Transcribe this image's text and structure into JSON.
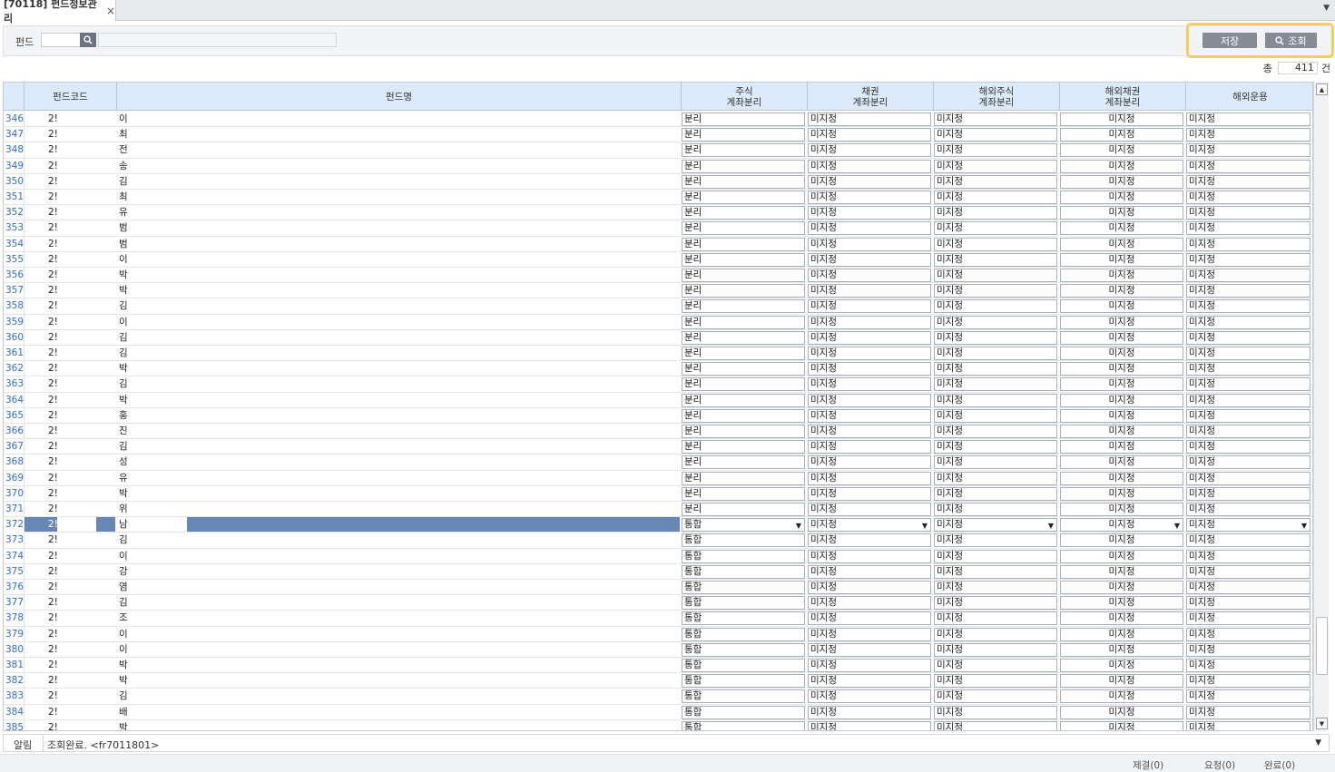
{
  "tab": {
    "title": "[70118] 펀드정보관리",
    "close": "×"
  },
  "search": {
    "label": "펀드",
    "code_value": "",
    "name_value": ""
  },
  "buttons": {
    "save": "저장",
    "query": "조회"
  },
  "count": {
    "prefix": "총",
    "value": "411",
    "suffix": "건"
  },
  "columns": [
    {
      "key": "code",
      "label": "펀드코드"
    },
    {
      "key": "name",
      "label": "펀드명"
    },
    {
      "key": "stock",
      "label": "주식\n계좌분리"
    },
    {
      "key": "bond",
      "label": "채권\n계좌분리"
    },
    {
      "key": "ostock",
      "label": "해외주식\n계좌분리"
    },
    {
      "key": "obond",
      "label": "해외채권\n계좌분리"
    },
    {
      "key": "overseas",
      "label": "해외운용"
    }
  ],
  "selected_row": 372,
  "rows": [
    {
      "no": "346",
      "code": "2!",
      "name": "이",
      "stock": "분리",
      "bond": "미지정",
      "ostock": "미지정",
      "obond": "미지정",
      "overseas": "미지정"
    },
    {
      "no": "347",
      "code": "2!",
      "name": "최",
      "stock": "분리",
      "bond": "미지정",
      "ostock": "미지정",
      "obond": "미지정",
      "overseas": "미지정"
    },
    {
      "no": "348",
      "code": "2!",
      "name": "전",
      "stock": "분리",
      "bond": "미지정",
      "ostock": "미지정",
      "obond": "미지정",
      "overseas": "미지정"
    },
    {
      "no": "349",
      "code": "2!",
      "name": "송",
      "stock": "분리",
      "bond": "미지정",
      "ostock": "미지정",
      "obond": "미지정",
      "overseas": "미지정"
    },
    {
      "no": "350",
      "code": "2!",
      "name": "김",
      "stock": "분리",
      "bond": "미지정",
      "ostock": "미지정",
      "obond": "미지정",
      "overseas": "미지정"
    },
    {
      "no": "351",
      "code": "2!",
      "name": "최",
      "stock": "분리",
      "bond": "미지정",
      "ostock": "미지정",
      "obond": "미지정",
      "overseas": "미지정"
    },
    {
      "no": "352",
      "code": "2!",
      "name": "유",
      "stock": "분리",
      "bond": "미지정",
      "ostock": "미지정",
      "obond": "미지정",
      "overseas": "미지정"
    },
    {
      "no": "353",
      "code": "2!",
      "name": "범",
      "stock": "분리",
      "bond": "미지정",
      "ostock": "미지정",
      "obond": "미지정",
      "overseas": "미지정"
    },
    {
      "no": "354",
      "code": "2!",
      "name": "범",
      "stock": "분리",
      "bond": "미지정",
      "ostock": "미지정",
      "obond": "미지정",
      "overseas": "미지정"
    },
    {
      "no": "355",
      "code": "2!",
      "name": "이",
      "stock": "분리",
      "bond": "미지정",
      "ostock": "미지정",
      "obond": "미지정",
      "overseas": "미지정"
    },
    {
      "no": "356",
      "code": "2!",
      "name": "박",
      "stock": "분리",
      "bond": "미지정",
      "ostock": "미지정",
      "obond": "미지정",
      "overseas": "미지정"
    },
    {
      "no": "357",
      "code": "2!",
      "name": "박",
      "stock": "분리",
      "bond": "미지정",
      "ostock": "미지정",
      "obond": "미지정",
      "overseas": "미지정"
    },
    {
      "no": "358",
      "code": "2!",
      "name": "김",
      "stock": "분리",
      "bond": "미지정",
      "ostock": "미지정",
      "obond": "미지정",
      "overseas": "미지정"
    },
    {
      "no": "359",
      "code": "2!",
      "name": "이",
      "stock": "분리",
      "bond": "미지정",
      "ostock": "미지정",
      "obond": "미지정",
      "overseas": "미지정"
    },
    {
      "no": "360",
      "code": "2!",
      "name": "김",
      "stock": "분리",
      "bond": "미지정",
      "ostock": "미지정",
      "obond": "미지정",
      "overseas": "미지정"
    },
    {
      "no": "361",
      "code": "2!",
      "name": "김",
      "stock": "분리",
      "bond": "미지정",
      "ostock": "미지정",
      "obond": "미지정",
      "overseas": "미지정"
    },
    {
      "no": "362",
      "code": "2!",
      "name": "박",
      "stock": "분리",
      "bond": "미지정",
      "ostock": "미지정",
      "obond": "미지정",
      "overseas": "미지정"
    },
    {
      "no": "363",
      "code": "2!",
      "name": "김",
      "stock": "분리",
      "bond": "미지정",
      "ostock": "미지정",
      "obond": "미지정",
      "overseas": "미지정"
    },
    {
      "no": "364",
      "code": "2!",
      "name": "박",
      "stock": "분리",
      "bond": "미지정",
      "ostock": "미지정",
      "obond": "미지정",
      "overseas": "미지정"
    },
    {
      "no": "365",
      "code": "2!",
      "name": "홍",
      "stock": "분리",
      "bond": "미지정",
      "ostock": "미지정",
      "obond": "미지정",
      "overseas": "미지정"
    },
    {
      "no": "366",
      "code": "2!",
      "name": "진",
      "stock": "분리",
      "bond": "미지정",
      "ostock": "미지정",
      "obond": "미지정",
      "overseas": "미지정"
    },
    {
      "no": "367",
      "code": "2!",
      "name": "김",
      "stock": "분리",
      "bond": "미지정",
      "ostock": "미지정",
      "obond": "미지정",
      "overseas": "미지정"
    },
    {
      "no": "368",
      "code": "2!",
      "name": "성",
      "stock": "분리",
      "bond": "미지정",
      "ostock": "미지정",
      "obond": "미지정",
      "overseas": "미지정"
    },
    {
      "no": "369",
      "code": "2!",
      "name": "유",
      "stock": "분리",
      "bond": "미지정",
      "ostock": "미지정",
      "obond": "미지정",
      "overseas": "미지정"
    },
    {
      "no": "370",
      "code": "2!",
      "name": "박",
      "stock": "분리",
      "bond": "미지정",
      "ostock": "미지정",
      "obond": "미지정",
      "overseas": "미지정"
    },
    {
      "no": "371",
      "code": "2!",
      "name": "위",
      "stock": "분리",
      "bond": "미지정",
      "ostock": "미지정",
      "obond": "미지정",
      "overseas": "미지정"
    },
    {
      "no": "372",
      "code": "2!",
      "name": "남",
      "stock": "통합",
      "bond": "미지정",
      "ostock": "미지정",
      "obond": "미지정",
      "overseas": "미지정"
    },
    {
      "no": "373",
      "code": "2!",
      "name": "김",
      "stock": "통합",
      "bond": "미지정",
      "ostock": "미지정",
      "obond": "미지정",
      "overseas": "미지정"
    },
    {
      "no": "374",
      "code": "2!",
      "name": "이",
      "stock": "통합",
      "bond": "미지정",
      "ostock": "미지정",
      "obond": "미지정",
      "overseas": "미지정"
    },
    {
      "no": "375",
      "code": "2!",
      "name": "강",
      "stock": "통합",
      "bond": "미지정",
      "ostock": "미지정",
      "obond": "미지정",
      "overseas": "미지정"
    },
    {
      "no": "376",
      "code": "2!",
      "name": "염",
      "stock": "통합",
      "bond": "미지정",
      "ostock": "미지정",
      "obond": "미지정",
      "overseas": "미지정"
    },
    {
      "no": "377",
      "code": "2!",
      "name": "김",
      "stock": "통합",
      "bond": "미지정",
      "ostock": "미지정",
      "obond": "미지정",
      "overseas": "미지정"
    },
    {
      "no": "378",
      "code": "2!",
      "name": "조",
      "stock": "통합",
      "bond": "미지정",
      "ostock": "미지정",
      "obond": "미지정",
      "overseas": "미지정"
    },
    {
      "no": "379",
      "code": "2!",
      "name": "이",
      "stock": "통합",
      "bond": "미지정",
      "ostock": "미지정",
      "obond": "미지정",
      "overseas": "미지정"
    },
    {
      "no": "380",
      "code": "2!",
      "name": "이",
      "stock": "통합",
      "bond": "미지정",
      "ostock": "미지정",
      "obond": "미지정",
      "overseas": "미지정"
    },
    {
      "no": "381",
      "code": "2!",
      "name": "박",
      "stock": "통합",
      "bond": "미지정",
      "ostock": "미지정",
      "obond": "미지정",
      "overseas": "미지정"
    },
    {
      "no": "382",
      "code": "2!",
      "name": "박",
      "stock": "통합",
      "bond": "미지정",
      "ostock": "미지정",
      "obond": "미지정",
      "overseas": "미지정"
    },
    {
      "no": "383",
      "code": "2!",
      "name": "김",
      "stock": "통합",
      "bond": "미지정",
      "ostock": "미지정",
      "obond": "미지정",
      "overseas": "미지정"
    },
    {
      "no": "384",
      "code": "2!",
      "name": "배",
      "stock": "통합",
      "bond": "미지정",
      "ostock": "미지정",
      "obond": "미지정",
      "overseas": "미지정"
    },
    {
      "no": "385",
      "code": "2!",
      "name": "박",
      "stock": "통합",
      "bond": "미지정",
      "ostock": "미지정",
      "obond": "미지정",
      "overseas": "미지정"
    }
  ],
  "message": {
    "label": "알림",
    "text": "조회완료. <fr7011801>"
  },
  "status": {
    "reject": "제결(0)",
    "request": "요청(0)",
    "done": "완료(0)"
  },
  "colors": {
    "selection": "#6887b5",
    "header_bg": "#ddeafc",
    "highlight": "#f7cf57",
    "row_number": "#2f6dd0"
  }
}
